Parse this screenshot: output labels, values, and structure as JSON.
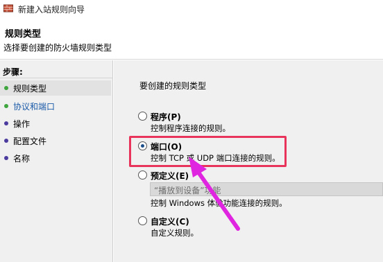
{
  "window": {
    "title": "新建入站规则向导"
  },
  "header": {
    "title": "规则类型",
    "subtitle": "选择要创建的防火墙规则类型"
  },
  "sidebar": {
    "steps_title": "步骤:",
    "steps": [
      {
        "label": "规则类型",
        "state": "current"
      },
      {
        "label": "协议和端口",
        "state": "link"
      },
      {
        "label": "操作",
        "state": "pending"
      },
      {
        "label": "配置文件",
        "state": "pending"
      },
      {
        "label": "名称",
        "state": "pending"
      }
    ]
  },
  "main": {
    "question": "要创建的规则类型",
    "options": [
      {
        "label": "程序(P)",
        "description": "控制程序连接的规则。",
        "selected": false
      },
      {
        "label": "端口(O)",
        "description": "控制 TCP 或 UDP 端口连接的规则。",
        "selected": true
      },
      {
        "label": "预定义(E)",
        "description": "控制 Windows 体验功能连接的规则。",
        "selected": false
      },
      {
        "label": "自定义(C)",
        "description": "自定义规则。",
        "selected": false
      }
    ],
    "predefined_combo_value": "“播放到设备”功能"
  },
  "colors": {
    "highlight": "#e8345a",
    "arrow": "#e025e0",
    "green_dot": "#3fa63f",
    "purple_dot": "#4b3b9e",
    "link": "#1a5aa8"
  }
}
